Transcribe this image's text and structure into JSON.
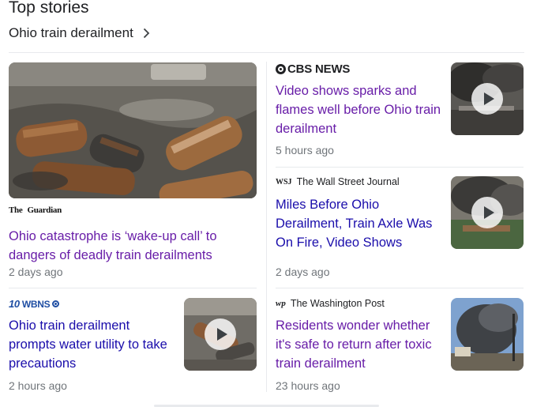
{
  "header": {
    "title": "Top stories",
    "topic": "Ohio train derailment"
  },
  "stories": [
    {
      "id": "guardian",
      "source": "The Guardian",
      "logo_line1": "The",
      "logo_line2": "Guardian",
      "headline": "Ohio catastrophe is ‘wake-up call’ to dangers of deadly train derailments",
      "time": "2 days ago",
      "has_video": false
    },
    {
      "id": "wbns",
      "source": "10WBNS",
      "logo_num": "10",
      "logo_text": "WBNS",
      "headline": "Ohio train derailment prompts water utility to take precautions",
      "time": "2 hours ago",
      "has_video": true
    },
    {
      "id": "cbs",
      "source": "CBS NEWS",
      "headline": "Video shows sparks and flames well before Ohio train derailment",
      "time": "5 hours ago",
      "has_video": true
    },
    {
      "id": "wsj",
      "source": "The Wall Street Journal",
      "logo_mark": "WSJ",
      "headline": "Miles Before Ohio Derailment, Train Axle Was On Fire, Video Shows",
      "time": "2 days ago",
      "has_video": true
    },
    {
      "id": "wapo",
      "source": "The Washington Post",
      "logo_mark": "wp",
      "headline": "Residents wonder whether it's safe to return after toxic train derailment",
      "time": "23 hours ago",
      "has_video": false
    }
  ],
  "icons": {
    "topic_chevron": "chevron-right-icon",
    "play": "play-icon"
  }
}
